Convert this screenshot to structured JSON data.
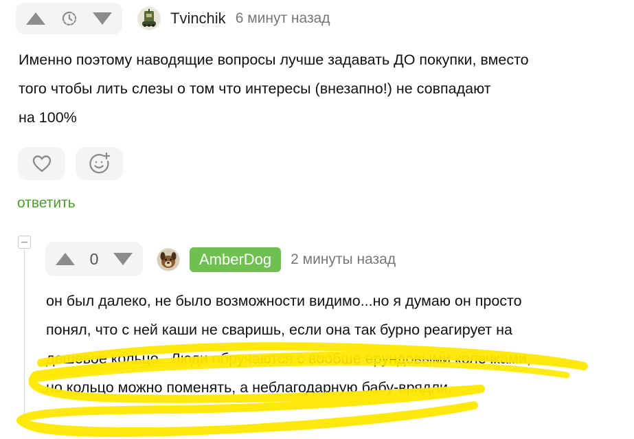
{
  "colors": {
    "accent_green": "#4a9e2d",
    "badge_green": "#6fc14f",
    "highlight_yellow": "#ffe800",
    "icon_gray": "#8c8c8c"
  },
  "comment1": {
    "author": "Tvinchik",
    "time": "6 минут назад",
    "rating_icon": "clock-icon",
    "avatar_icon": "tank-avatar",
    "text_lines": [
      "Именно поэтому наводящие вопросы лучше задавать ДО покупки, вместо",
      "того чтобы лить слезы о том что интересы (внезапно!) не совпадают",
      "на 100%"
    ],
    "actions": {
      "like_icon": "heart-icon",
      "react_icon": "emoji-add-icon"
    },
    "reply_label": "ответить"
  },
  "comment2": {
    "author": "AmberDog",
    "time": "2 минуты назад",
    "rating": "0",
    "avatar_icon": "dog-avatar",
    "collapse_icon": "minus-icon",
    "text_lines": [
      "он был далеко, не было возможности видимо...но я думаю он просто",
      "понял, что с ней каши не сваришь, если она так бурно реагирует на",
      "дешевое кольцо...Люди обручаются с вообше ерундовыми колечками,",
      "но кольцо можно поменять, а неблагодарную бабу-врядли."
    ]
  }
}
